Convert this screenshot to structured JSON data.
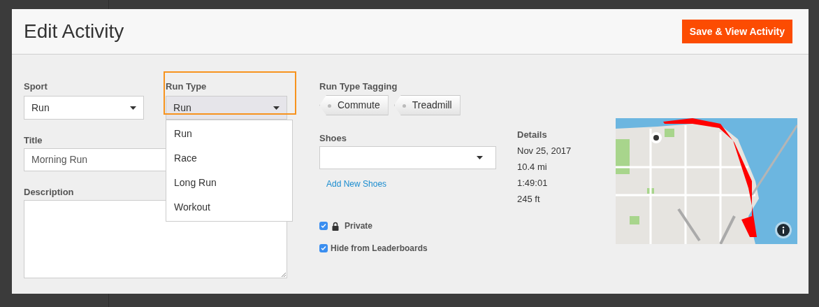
{
  "modal": {
    "title": "Edit Activity",
    "primary_button": "Save & View Activity"
  },
  "sport": {
    "label": "Sport",
    "value": "Run"
  },
  "run_type": {
    "label": "Run Type",
    "value": "Run",
    "expanded": true,
    "highlighted": true,
    "options": [
      "Run",
      "Race",
      "Long Run",
      "Workout"
    ]
  },
  "title_field": {
    "label": "Title",
    "value": "Morning Run"
  },
  "description": {
    "label": "Description"
  },
  "tagging": {
    "label": "Run Type Tagging",
    "tags": [
      "Commute",
      "Treadmill"
    ]
  },
  "shoes": {
    "label": "Shoes",
    "link": "Add New Shoes"
  },
  "details": {
    "label": "Details",
    "lines": [
      "Nov 25, 2017",
      "10.4 mi",
      "1:49:01",
      "245 ft"
    ]
  },
  "checkboxes": [
    {
      "kind": "private",
      "label": "Private",
      "checked": true
    },
    {
      "kind": "plain",
      "label": "Hide from Leaderboards",
      "checked": true
    }
  ]
}
